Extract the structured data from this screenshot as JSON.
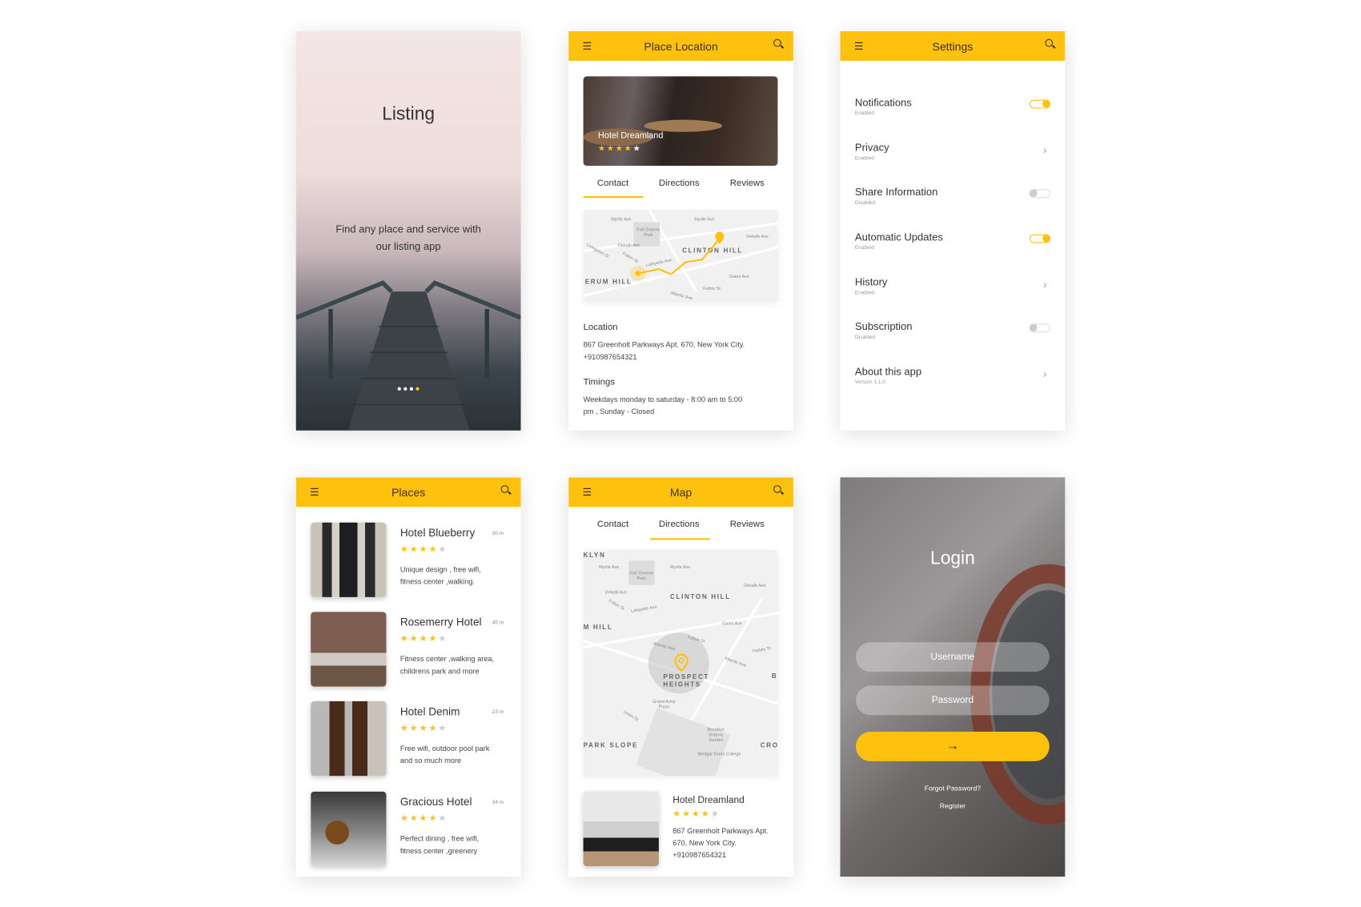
{
  "colors": {
    "accent": "#FDC10E",
    "text": "#333333"
  },
  "listing": {
    "title": "Listing",
    "subtitle_line1": "Find any place and service with",
    "subtitle_line2": "our listing app",
    "page_dots": 4,
    "active_dot": 4
  },
  "place_location": {
    "title": "Place Location",
    "menu_icon": "hamburger-icon",
    "search_icon": "search-icon",
    "hero_name": "Hotel Dreamland",
    "hero_rating": 4,
    "tabs": [
      "Contact",
      "Directions",
      "Reviews"
    ],
    "active_tab": "Contact",
    "map_labels": {
      "myrtle1": "Myrtle Ave",
      "myrtle2": "Myrtle Ave",
      "fort": "Fort Greene Park",
      "dekalb1": "Dekalb Ave",
      "dekalb2": "Dekalb Ave",
      "clinton": "CLINTON HILL",
      "lafayette": "Lafayette Ave",
      "fulton1": "Fulton St",
      "fulton2": "Fulton St",
      "livingston": "Livingston St",
      "gates": "Gates Ave",
      "erum": "ERUM HILL",
      "atlantic": "Atlantic Ave"
    },
    "location_label": "Location",
    "address": "867 Greenholt Parkways Apt. 670, New York City.",
    "phone": "+910987654321",
    "timings_label": "Timings",
    "timings_line1": "Weekdays  monday to saturday - 8:00 am to 5:00",
    "timings_line2": "pm , Sunday - Closed"
  },
  "settings": {
    "title": "Settings",
    "items": [
      {
        "title": "Notifications",
        "status": "Enabled",
        "control": "toggle",
        "on": true
      },
      {
        "title": "Privacy",
        "status": "Enabled",
        "control": "chevron"
      },
      {
        "title": "Share Information",
        "status": "Disabled",
        "control": "toggle",
        "on": false
      },
      {
        "title": "Automatic Updates",
        "status": "Enabled",
        "control": "toggle",
        "on": true
      },
      {
        "title": "History",
        "status": "Enabled",
        "control": "chevron"
      },
      {
        "title": "Subscription",
        "status": "Disabled",
        "control": "toggle",
        "on": false
      },
      {
        "title": "About this app",
        "status": "Version 1.1.0",
        "control": "chevron"
      }
    ]
  },
  "places": {
    "title": "Places",
    "items": [
      {
        "name": "Hotel Blueberry",
        "distance": "30 m",
        "rating": 4,
        "desc1": "Unique design , free  wifi,",
        "desc2": "fitness center ,walking."
      },
      {
        "name": "Rosemerry Hotel",
        "distance": "45 m",
        "rating": 4,
        "desc1": "Fitness center ,walking area,",
        "desc2": "childrens park and more"
      },
      {
        "name": "Hotel Denim",
        "distance": "23 m",
        "rating": 4,
        "desc1": "Free  wifi, outdoor pool park",
        "desc2": "and so much more"
      },
      {
        "name": "Gracious Hotel",
        "distance": "34 m",
        "rating": 4,
        "desc1": "Perfect dining , free  wifi,",
        "desc2": "fitness center ,greenery"
      }
    ]
  },
  "map": {
    "title": "Map",
    "tabs": [
      "Contact",
      "Directions",
      "Reviews"
    ],
    "active_tab": "Directions",
    "map_labels": {
      "klyn": "KLYN",
      "myrtle1": "Myrtle Ave",
      "myrtle2": "Myrtle Ave",
      "fort": "Fort Greene Park",
      "dekalb1": "Dekalb Ave",
      "dekalb2": "Dekalb Ave",
      "clinton": "CLINTON HILL",
      "lafayette": "Lafayette Ave",
      "fulton1": "Fulton St",
      "fulton2": "Fulton St",
      "gates": "Gates Ave",
      "mhill": "M HILL",
      "atlantic1": "Atlantic Ave",
      "atlantic2": "Atlantic Ave",
      "halsey": "Halsey St",
      "prospect": "PROSPECT HEIGHTS",
      "grand": "Grand Army Plaza",
      "union": "Union St",
      "botanic": "Brooklyn Botanic Garden",
      "park": "PARK SLOPE",
      "cro": "CRO",
      "medgar": "Medgar Evers College",
      "b": "B"
    },
    "result": {
      "name": "Hotel Dreamland",
      "rating": 4,
      "addr1": "867 Greenholt Parkways Apt.",
      "addr2": "670, New York City.",
      "phone": "+910987654321"
    }
  },
  "login": {
    "title": "Login",
    "username_placeholder": "Username",
    "password_placeholder": "Password",
    "submit_icon": "arrow-right-icon",
    "forgot": "Forgot Password?",
    "register": "Register"
  }
}
